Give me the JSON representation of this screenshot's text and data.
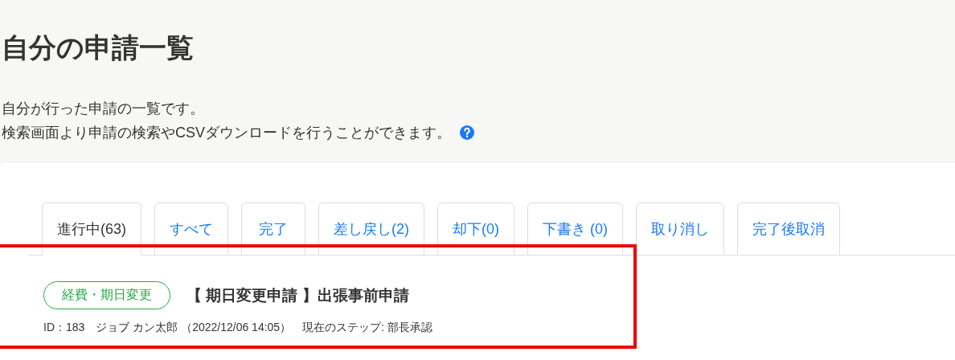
{
  "page": {
    "title": "自分の申請一覧",
    "description": [
      "自分が行った申請の一覧です。",
      "検索画面より申請の検索やCSVダウンロードを行うことができます。"
    ],
    "help_icon": true
  },
  "tabs": [
    {
      "label": "進行中(63)",
      "selected": true
    },
    {
      "label": "すべて",
      "selected": false
    },
    {
      "label": "完了",
      "selected": false
    },
    {
      "label": "差し戻し(2)",
      "selected": false
    },
    {
      "label": "却下(0)",
      "selected": false
    },
    {
      "label": "下書き (0)",
      "selected": false
    },
    {
      "label": "取り消し",
      "selected": false
    },
    {
      "label": "完了後取消",
      "selected": false
    }
  ],
  "requests": [
    {
      "tag": "経費・期日変更",
      "color": "#22aa44",
      "title": "【 期日変更申請 】出張事前申請",
      "meta": "ID：183　ジョブ カン太郎 （2022/12/06 14:05）　現在のステップ: 部長承認",
      "highlighted": true
    }
  ]
}
